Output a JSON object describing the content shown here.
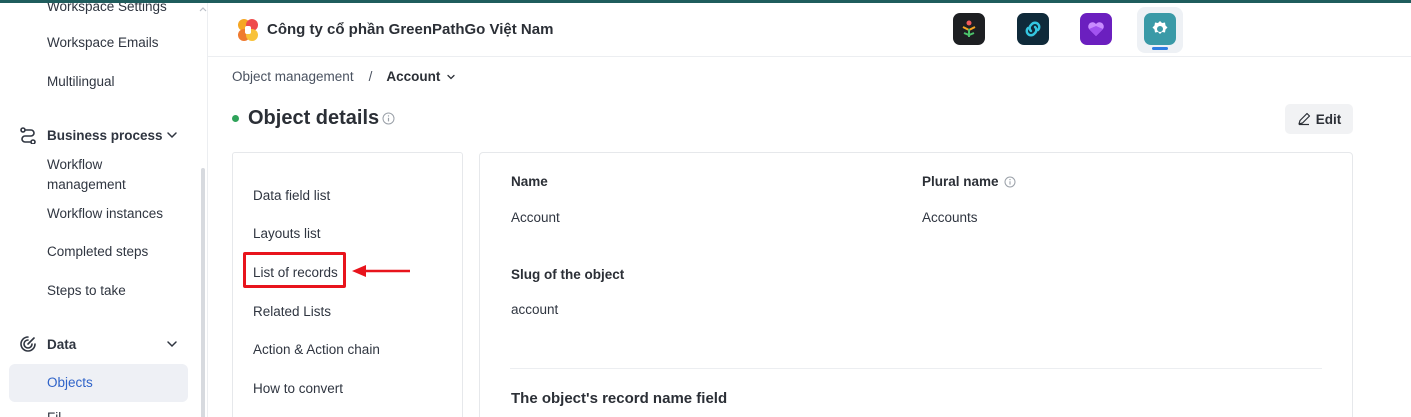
{
  "sidebar": {
    "items_top": [
      "Workspace Settings",
      "Workspace Emails",
      "Multilingual"
    ],
    "business_process": {
      "label": "Business process",
      "icon": "workflow-icon",
      "items": [
        "Workflow management",
        "Workflow instances",
        "Completed steps",
        "Steps to take"
      ]
    },
    "data": {
      "label": "Data",
      "icon": "data-icon",
      "items": [
        "Objects",
        "Fil..."
      ],
      "active": "Objects"
    }
  },
  "header": {
    "company_name": "Công ty cổ phần GreenPathGo Việt Nam",
    "apps": [
      "tree-app-icon",
      "link-app-icon",
      "heart-app-icon",
      "gear-app-icon"
    ],
    "active_app": "gear-app-icon"
  },
  "breadcrumb": {
    "parent": "Object management",
    "separator": "/",
    "current": "Account"
  },
  "page": {
    "title": "Object details",
    "edit_label": "Edit"
  },
  "menu": {
    "items": [
      "Data field list",
      "Layouts list",
      "List of records",
      "Related Lists",
      "Action & Action chain",
      "How to convert"
    ],
    "highlighted": "List of records"
  },
  "details": {
    "name_label": "Name",
    "name_value": "Account",
    "plural_label": "Plural name",
    "plural_value": "Accounts",
    "slug_label": "Slug of the object",
    "slug_value": "account",
    "record_name_section": "The object's record name field"
  },
  "colors": {
    "accent_green": "#2fa35a",
    "highlight_red": "#e8141c",
    "active_app_bar": "#2f7de1"
  }
}
